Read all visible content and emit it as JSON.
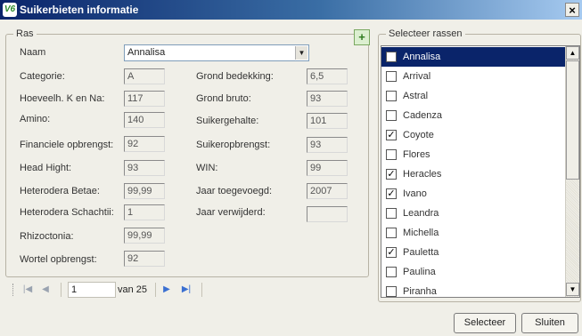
{
  "window": {
    "title": "Suikerbieten informatie",
    "close_symbol": "×"
  },
  "ras": {
    "group_title": "Ras",
    "naam_label": "Naam",
    "naam_value": "Annalisa",
    "add_icon": "add-record-icon",
    "left_fields": [
      {
        "label": "Categorie:",
        "value": "A"
      },
      {
        "label": "Hoeveelh. K en Na:",
        "value": "117"
      },
      {
        "label": "Amino:",
        "value": "140"
      },
      {
        "label": "Financiele opbrengst:",
        "value": "92"
      },
      {
        "label": "Head Hight:",
        "value": "93"
      },
      {
        "label": "Heterodera Betae:",
        "value": "99,99"
      },
      {
        "label": "Heterodera Schachtii:",
        "value": "1"
      },
      {
        "label": "Rhizoctonia:",
        "value": "99,99"
      },
      {
        "label": "Wortel opbrengst:",
        "value": "92"
      }
    ],
    "right_fields": [
      {
        "label": "Grond bedekking:",
        "value": "6,5"
      },
      {
        "label": "Grond bruto:",
        "value": "93"
      },
      {
        "label": "Suikergehalte:",
        "value": "101"
      },
      {
        "label": "Suikeropbrengst:",
        "value": "93"
      },
      {
        "label": "WIN:",
        "value": "99"
      },
      {
        "label": "Jaar toegevoegd:",
        "value": "2007"
      },
      {
        "label": "Jaar verwijderd:",
        "value": ""
      }
    ]
  },
  "navigator": {
    "position": "1",
    "count": "van 25",
    "colors": {
      "active": "#3a6fd1",
      "inactive": "#9aa3b0"
    }
  },
  "selectie": {
    "group_title": "Selecteer rassen",
    "items": [
      {
        "label": "Annalisa",
        "checked": false,
        "selected": true
      },
      {
        "label": "Arrival",
        "checked": false,
        "selected": false
      },
      {
        "label": "Astral",
        "checked": false,
        "selected": false
      },
      {
        "label": "Cadenza",
        "checked": false,
        "selected": false
      },
      {
        "label": "Coyote",
        "checked": true,
        "selected": false
      },
      {
        "label": "Flores",
        "checked": false,
        "selected": false
      },
      {
        "label": "Heracles",
        "checked": true,
        "selected": false
      },
      {
        "label": "Ivano",
        "checked": true,
        "selected": false
      },
      {
        "label": "Leandra",
        "checked": false,
        "selected": false
      },
      {
        "label": "Michella",
        "checked": false,
        "selected": false
      },
      {
        "label": "Pauletta",
        "checked": true,
        "selected": false
      },
      {
        "label": "Paulina",
        "checked": false,
        "selected": false
      },
      {
        "label": "Piranha",
        "checked": false,
        "selected": false
      }
    ]
  },
  "buttons": {
    "selecteer": "Selecteer",
    "sluiten": "Sluiten"
  }
}
